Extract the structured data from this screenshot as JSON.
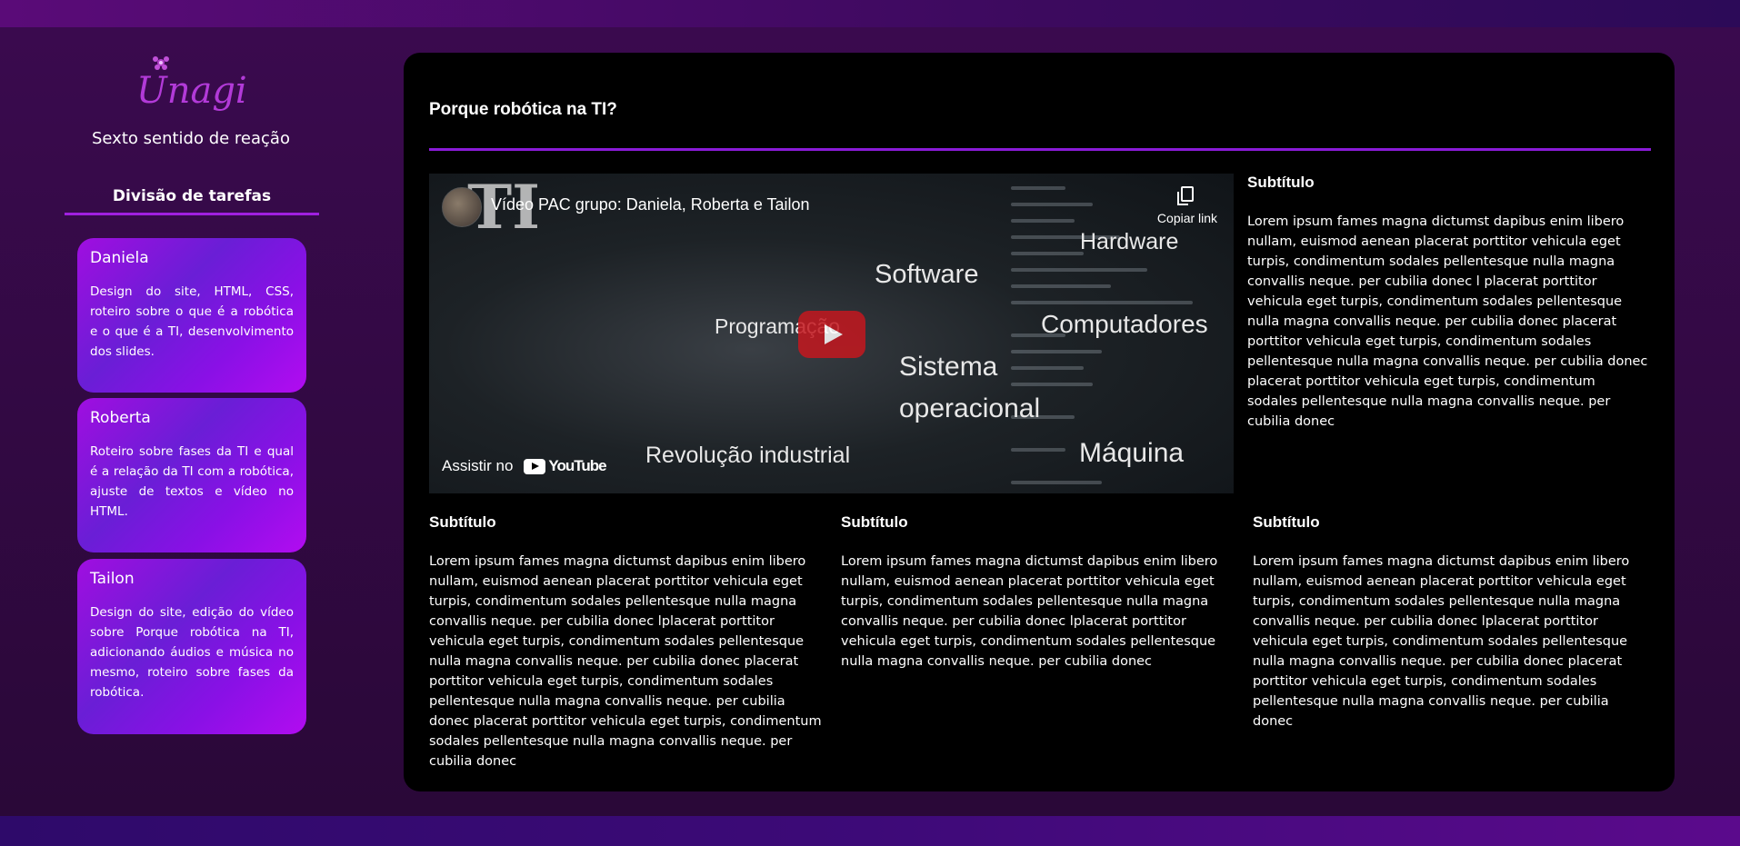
{
  "brand": {
    "logo_text": "Unagi",
    "tagline": "Sexto sentido de reação"
  },
  "colors": {
    "accent": "#8a1bd8",
    "card_gradient_start": "#a00ee0",
    "card_gradient_end": "#6a1ed6",
    "main_background": "#000000",
    "page_background": "#2e0a3c"
  },
  "sidebar": {
    "section_title": "Divisão de tarefas",
    "members": [
      {
        "name": "Daniela",
        "task": "Design do site, HTML, CSS, roteiro sobre o que é a robótica e o que é a TI, desenvolvimento dos slides."
      },
      {
        "name": "Roberta",
        "task": "Roteiro sobre fases da TI e qual é a relação da TI com a robótica, ajuste de textos e vídeo no HTML."
      },
      {
        "name": "Tailon",
        "task": "Design do site, edição do vídeo sobre Porque robótica na TI, adicionando áudios e música no mesmo, roteiro sobre fases da robótica."
      }
    ]
  },
  "main": {
    "title": "Porque robótica na TI?",
    "video": {
      "title": "Vídeo PAC grupo: Daniela, Roberta e Tailon",
      "copy_link_label": "Copiar link",
      "watch_on_label": "Assistir no",
      "youtube_label": "YouTube",
      "overlay_letters": "TI",
      "overlay_words": {
        "hardware": "Hardware",
        "software": "Software",
        "programacao": "Programação",
        "computadores": "Computadores",
        "sistema": "Sistema",
        "operacional": "operacional",
        "revolucao": "Revolução industrial",
        "maquina": "Máquina"
      }
    },
    "side_section": {
      "subtitle": "Subtítulo",
      "text": "Lorem ipsum fames magna dictumst dapibus enim libero nullam, euismod aenean placerat porttitor vehicula eget turpis, condimentum sodales pellentesque nulla magna convallis neque. per cubilia donec l placerat porttitor vehicula eget turpis, condimentum sodales pellentesque nulla magna convallis neque. per cubilia donec placerat porttitor vehicula eget turpis, condimentum sodales pellentesque nulla magna convallis neque. per cubilia donec placerat porttitor vehicula eget turpis, condimentum sodales pellentesque nulla magna convallis neque. per cubilia donec"
    },
    "sections": [
      {
        "subtitle": "Subtítulo",
        "text": "Lorem ipsum fames magna dictumst dapibus enim libero nullam, euismod aenean placerat porttitor vehicula eget turpis, condimentum sodales pellentesque nulla magna convallis neque. per cubilia donec lplacerat porttitor vehicula eget turpis, condimentum sodales pellentesque nulla magna convallis neque. per cubilia donec placerat porttitor vehicula eget turpis, condimentum sodales pellentesque nulla magna convallis neque. per cubilia donec placerat porttitor vehicula eget turpis, condimentum sodales pellentesque nulla magna convallis neque. per cubilia donec"
      },
      {
        "subtitle": "Subtítulo",
        "text": "Lorem ipsum fames magna dictumst dapibus enim libero nullam, euismod aenean placerat porttitor vehicula eget turpis, condimentum sodales pellentesque nulla magna convallis neque. per cubilia donec lplacerat porttitor vehicula eget turpis, condimentum sodales pellentesque nulla magna convallis neque. per cubilia donec"
      },
      {
        "subtitle": "Subtítulo",
        "text": "Lorem ipsum fames magna dictumst dapibus enim libero nullam, euismod aenean placerat porttitor vehicula eget turpis, condimentum sodales pellentesque nulla magna convallis neque. per cubilia donec lplacerat porttitor vehicula eget turpis, condimentum sodales pellentesque nulla magna convallis neque. per cubilia donec placerat porttitor vehicula eget turpis, condimentum sodales pellentesque nulla magna convallis neque. per cubilia donec"
      }
    ]
  }
}
